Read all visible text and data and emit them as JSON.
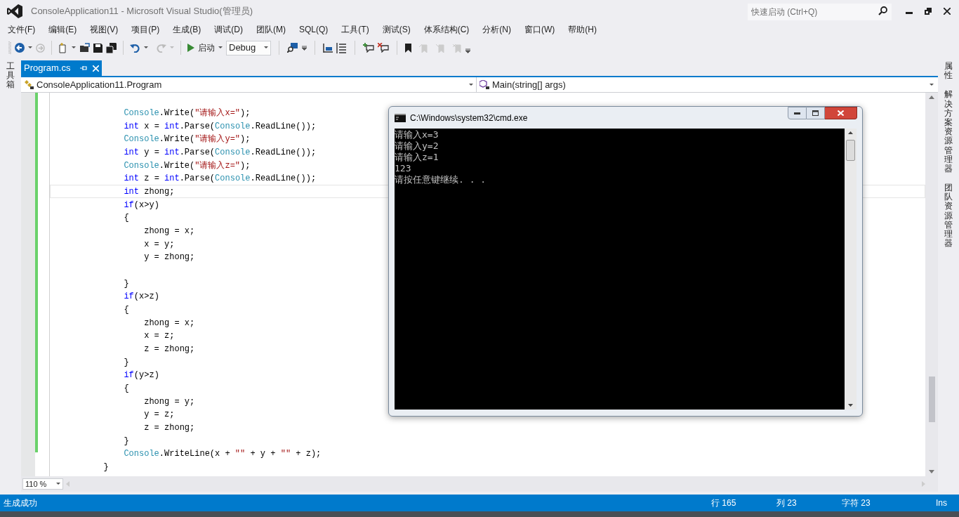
{
  "window": {
    "title": "ConsoleApplication11 - Microsoft Visual Studio(管理员)"
  },
  "quick_launch": {
    "placeholder": "快速启动 (Ctrl+Q)"
  },
  "menu": [
    "文件(F)",
    "编辑(E)",
    "视图(V)",
    "项目(P)",
    "生成(B)",
    "调试(D)",
    "团队(M)",
    "SQL(Q)",
    "工具(T)",
    "测试(S)",
    "体系结构(C)",
    "分析(N)",
    "窗口(W)",
    "帮助(H)"
  ],
  "toolbar": {
    "start_label": "启动",
    "configuration": "Debug"
  },
  "left_rail": [
    "工具箱"
  ],
  "right_rail": [
    "属性",
    "解决方案资源管理器",
    "团队资源管理器"
  ],
  "tabs": [
    {
      "label": "Program.cs",
      "selected": true
    }
  ],
  "navigation": {
    "type_dropdown": "ConsoleApplication11.Program",
    "member_dropdown": "Main(string[] args)"
  },
  "editor": {
    "lines": [
      {
        "kind": "code",
        "current": false,
        "tokens": [
          {
            "text": "            Console",
            "kind": "type"
          },
          {
            "text": ".Write(",
            "kind": "plain"
          },
          {
            "text": "\"请输入x=\"",
            "kind": "str"
          },
          {
            "text": ");",
            "kind": "plain"
          }
        ]
      },
      {
        "kind": "code",
        "current": false,
        "tokens": [
          {
            "text": "            int",
            "kind": "kw"
          },
          {
            "text": " x = ",
            "kind": "plain"
          },
          {
            "text": "int",
            "kind": "kw"
          },
          {
            "text": ".Parse(",
            "kind": "plain"
          },
          {
            "text": "Console",
            "kind": "type"
          },
          {
            "text": ".ReadLine());",
            "kind": "plain"
          }
        ]
      },
      {
        "kind": "code",
        "current": false,
        "tokens": [
          {
            "text": "            Console",
            "kind": "type"
          },
          {
            "text": ".Write(",
            "kind": "plain"
          },
          {
            "text": "\"请输入y=\"",
            "kind": "str"
          },
          {
            "text": ");",
            "kind": "plain"
          }
        ]
      },
      {
        "kind": "code",
        "current": false,
        "tokens": [
          {
            "text": "            int",
            "kind": "kw"
          },
          {
            "text": " y = ",
            "kind": "plain"
          },
          {
            "text": "int",
            "kind": "kw"
          },
          {
            "text": ".Parse(",
            "kind": "plain"
          },
          {
            "text": "Console",
            "kind": "type"
          },
          {
            "text": ".ReadLine());",
            "kind": "plain"
          }
        ]
      },
      {
        "kind": "code",
        "current": false,
        "tokens": [
          {
            "text": "            Console",
            "kind": "type"
          },
          {
            "text": ".Write(",
            "kind": "plain"
          },
          {
            "text": "\"请输入z=\"",
            "kind": "str"
          },
          {
            "text": ");",
            "kind": "plain"
          }
        ]
      },
      {
        "kind": "code",
        "current": false,
        "tokens": [
          {
            "text": "            int",
            "kind": "kw"
          },
          {
            "text": " z = ",
            "kind": "plain"
          },
          {
            "text": "int",
            "kind": "kw"
          },
          {
            "text": ".Parse(",
            "kind": "plain"
          },
          {
            "text": "Console",
            "kind": "type"
          },
          {
            "text": ".ReadLine());",
            "kind": "plain"
          }
        ]
      },
      {
        "kind": "code",
        "current": true,
        "tokens": [
          {
            "text": "            int",
            "kind": "kw"
          },
          {
            "text": " zhong;",
            "kind": "plain"
          }
        ]
      },
      {
        "kind": "code",
        "current": false,
        "tokens": [
          {
            "text": "            if",
            "kind": "kw"
          },
          {
            "text": "(x>y)",
            "kind": "plain"
          }
        ]
      },
      {
        "kind": "code",
        "current": false,
        "tokens": [
          {
            "text": "            {",
            "kind": "plain"
          }
        ]
      },
      {
        "kind": "code",
        "current": false,
        "tokens": [
          {
            "text": "                zhong = x;",
            "kind": "plain"
          }
        ]
      },
      {
        "kind": "code",
        "current": false,
        "tokens": [
          {
            "text": "                x = y;",
            "kind": "plain"
          }
        ]
      },
      {
        "kind": "code",
        "current": false,
        "tokens": [
          {
            "text": "                y = zhong;",
            "kind": "plain"
          }
        ]
      },
      {
        "kind": "blank",
        "current": false
      },
      {
        "kind": "code",
        "current": false,
        "tokens": [
          {
            "text": "            }",
            "kind": "plain"
          }
        ]
      },
      {
        "kind": "code",
        "current": false,
        "tokens": [
          {
            "text": "            if",
            "kind": "kw"
          },
          {
            "text": "(x>z)",
            "kind": "plain"
          }
        ]
      },
      {
        "kind": "code",
        "current": false,
        "tokens": [
          {
            "text": "            {",
            "kind": "plain"
          }
        ]
      },
      {
        "kind": "code",
        "current": false,
        "tokens": [
          {
            "text": "                zhong = x;",
            "kind": "plain"
          }
        ]
      },
      {
        "kind": "code",
        "current": false,
        "tokens": [
          {
            "text": "                x = z;",
            "kind": "plain"
          }
        ]
      },
      {
        "kind": "code",
        "current": false,
        "tokens": [
          {
            "text": "                z = zhong;",
            "kind": "plain"
          }
        ]
      },
      {
        "kind": "code",
        "current": false,
        "tokens": [
          {
            "text": "            }",
            "kind": "plain"
          }
        ]
      },
      {
        "kind": "code",
        "current": false,
        "tokens": [
          {
            "text": "            if",
            "kind": "kw"
          },
          {
            "text": "(y>z)",
            "kind": "plain"
          }
        ]
      },
      {
        "kind": "code",
        "current": false,
        "tokens": [
          {
            "text": "            {",
            "kind": "plain"
          }
        ]
      },
      {
        "kind": "code",
        "current": false,
        "tokens": [
          {
            "text": "                zhong = y;",
            "kind": "plain"
          }
        ]
      },
      {
        "kind": "code",
        "current": false,
        "tokens": [
          {
            "text": "                y = z;",
            "kind": "plain"
          }
        ]
      },
      {
        "kind": "code",
        "current": false,
        "tokens": [
          {
            "text": "                z = zhong;",
            "kind": "plain"
          }
        ]
      },
      {
        "kind": "code",
        "current": false,
        "tokens": [
          {
            "text": "            }",
            "kind": "plain"
          }
        ]
      },
      {
        "kind": "code",
        "current": false,
        "tokens": [
          {
            "text": "            Console",
            "kind": "type"
          },
          {
            "text": ".WriteLine(x + ",
            "kind": "plain"
          },
          {
            "text": "\"\"",
            "kind": "str"
          },
          {
            "text": " + y + ",
            "kind": "plain"
          },
          {
            "text": "\"\"",
            "kind": "str"
          },
          {
            "text": " + z);",
            "kind": "plain"
          }
        ]
      },
      {
        "kind": "code",
        "current": false,
        "tokens": [
          {
            "text": "        }",
            "kind": "plain"
          }
        ]
      }
    ]
  },
  "zoom": "110 %",
  "console": {
    "title": "C:\\Windows\\system32\\cmd.exe",
    "output": [
      "请输入x=3",
      "请输入y=2",
      "请输入z=1",
      "123",
      "请按任意键继续. . ."
    ]
  },
  "status_bar": {
    "message": "生成成功",
    "line": "行 165",
    "column": "列 23",
    "char": "字符 23",
    "mode": "Ins"
  }
}
